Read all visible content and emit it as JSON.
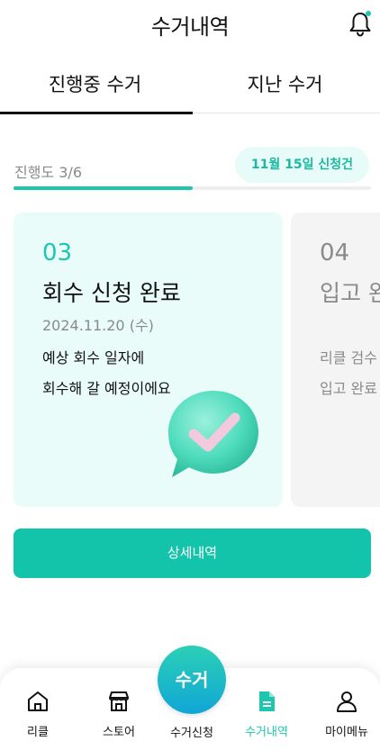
{
  "header": {
    "title": "수거내역",
    "notification_icon": "bell-icon"
  },
  "tabs": [
    {
      "label": "진행중 수거",
      "active": true
    },
    {
      "label": "지난 수거",
      "active": false
    }
  ],
  "progress": {
    "label": "진행도 3/6",
    "current": 3,
    "total": 6,
    "fraction": 0.5,
    "request_badge": "11월 15일 신청건"
  },
  "steps": [
    {
      "number": "03",
      "title": "회수 신청 완료",
      "date": "2024.11.20 (수)",
      "desc_line1": "예상 회수 일자에",
      "desc_line2": "회수해 갈 예정이에요",
      "icon": "check-bubble-icon"
    },
    {
      "number": "04",
      "title": "입고 완",
      "date": "",
      "desc_line1": "리클 검수",
      "desc_line2": "입고 완료"
    }
  ],
  "detail_button": {
    "label": "상세내역"
  },
  "bottom_nav": {
    "items": [
      {
        "label": "리클",
        "icon": "home-icon"
      },
      {
        "label": "스토어",
        "icon": "store-icon"
      },
      {
        "label": "수거신청",
        "icon": "pickup-fab"
      },
      {
        "label": "수거내역",
        "icon": "document-icon",
        "active": true
      },
      {
        "label": "마이메뉴",
        "icon": "person-icon"
      }
    ],
    "center_fab_label": "수거"
  },
  "colors": {
    "accent": "#1cc7ae",
    "badge_bg": "#e7fbf8",
    "card_bg": "#e9fcf9"
  }
}
